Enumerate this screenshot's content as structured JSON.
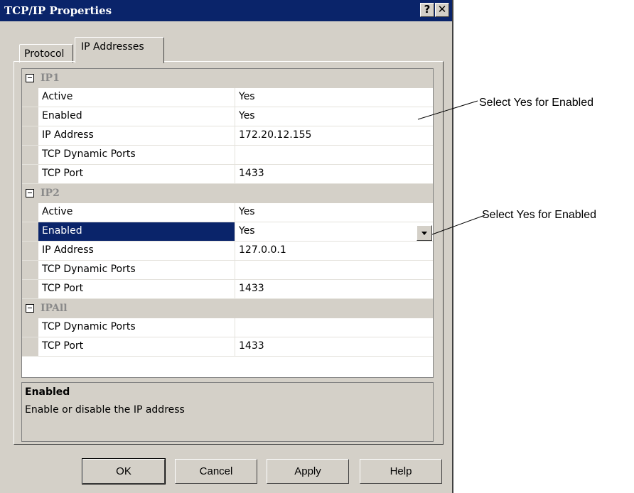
{
  "window": {
    "title": "TCP/IP Properties",
    "help_button": "?",
    "close_button": "✕"
  },
  "tabs": [
    {
      "label": "Protocol",
      "selected": false
    },
    {
      "label": "IP Addresses",
      "selected": true
    }
  ],
  "groups": [
    {
      "title": "IP1",
      "rows": [
        {
          "name": "Active",
          "value": "Yes"
        },
        {
          "name": "Enabled",
          "value": "Yes"
        },
        {
          "name": "IP Address",
          "value": "172.20.12.155"
        },
        {
          "name": "TCP Dynamic Ports",
          "value": ""
        },
        {
          "name": "TCP Port",
          "value": "1433"
        }
      ]
    },
    {
      "title": "IP2",
      "rows": [
        {
          "name": "Active",
          "value": "Yes"
        },
        {
          "name": "Enabled",
          "value": "Yes",
          "selected": true
        },
        {
          "name": "IP Address",
          "value": "127.0.0.1"
        },
        {
          "name": "TCP Dynamic Ports",
          "value": ""
        },
        {
          "name": "TCP Port",
          "value": "1433"
        }
      ]
    },
    {
      "title": "IPAll",
      "rows": [
        {
          "name": "TCP Dynamic Ports",
          "value": ""
        },
        {
          "name": "TCP Port",
          "value": "1433"
        }
      ]
    }
  ],
  "description": {
    "title": "Enabled",
    "text": "Enable or disable the IP address"
  },
  "buttons": {
    "ok": "OK",
    "cancel": "Cancel",
    "apply": "Apply",
    "help": "Help"
  },
  "callouts": [
    {
      "text": "Select Yes for Enabled"
    },
    {
      "text": "Select Yes for Enabled"
    }
  ],
  "colors": {
    "titlebar": "#0a246a",
    "face": "#d4d0c8",
    "selection": "#0a246a"
  }
}
